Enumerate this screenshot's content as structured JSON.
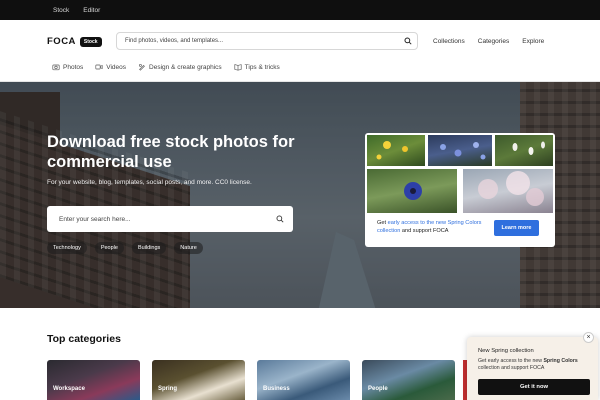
{
  "topbar": {
    "items": [
      "Stock",
      "Editor"
    ]
  },
  "header": {
    "logo": "FOCA",
    "badge": "Stock",
    "search_placeholder": "Find photos, videos, and templates...",
    "nav": [
      "Collections",
      "Categories",
      "Explore"
    ]
  },
  "subnav": [
    {
      "label": "Photos",
      "icon": "camera-icon"
    },
    {
      "label": "Videos",
      "icon": "video-icon"
    },
    {
      "label": "Design & create graphics",
      "icon": "design-icon"
    },
    {
      "label": "Tips & tricks",
      "icon": "book-icon"
    }
  ],
  "hero": {
    "title": "Download free stock photos for commercial use",
    "subtitle": "For your website, blog, templates, social posts, and more. CC0 license.",
    "search_placeholder": "Enter your search here...",
    "tags": [
      "Technology",
      "People",
      "Buildings",
      "Nature"
    ]
  },
  "promo": {
    "text_before": "Get ",
    "text_highlight": "early access to the new Spring Colors collection",
    "text_after": " and support FOCA",
    "button": "Learn more"
  },
  "categories": {
    "title": "Top categories",
    "items": [
      "Workspace",
      "Spring",
      "Business",
      "People"
    ]
  },
  "popup": {
    "title": "New Spring collection",
    "body_before": "Get early access to the new ",
    "body_bold": "Spring Colors",
    "body_after": " collection and support FOCA",
    "button": "Get it now",
    "close": "×"
  },
  "colors": {
    "accent": "#2f6fde",
    "dark": "#0f0f0f",
    "popup_bg": "#f6f0e8"
  }
}
